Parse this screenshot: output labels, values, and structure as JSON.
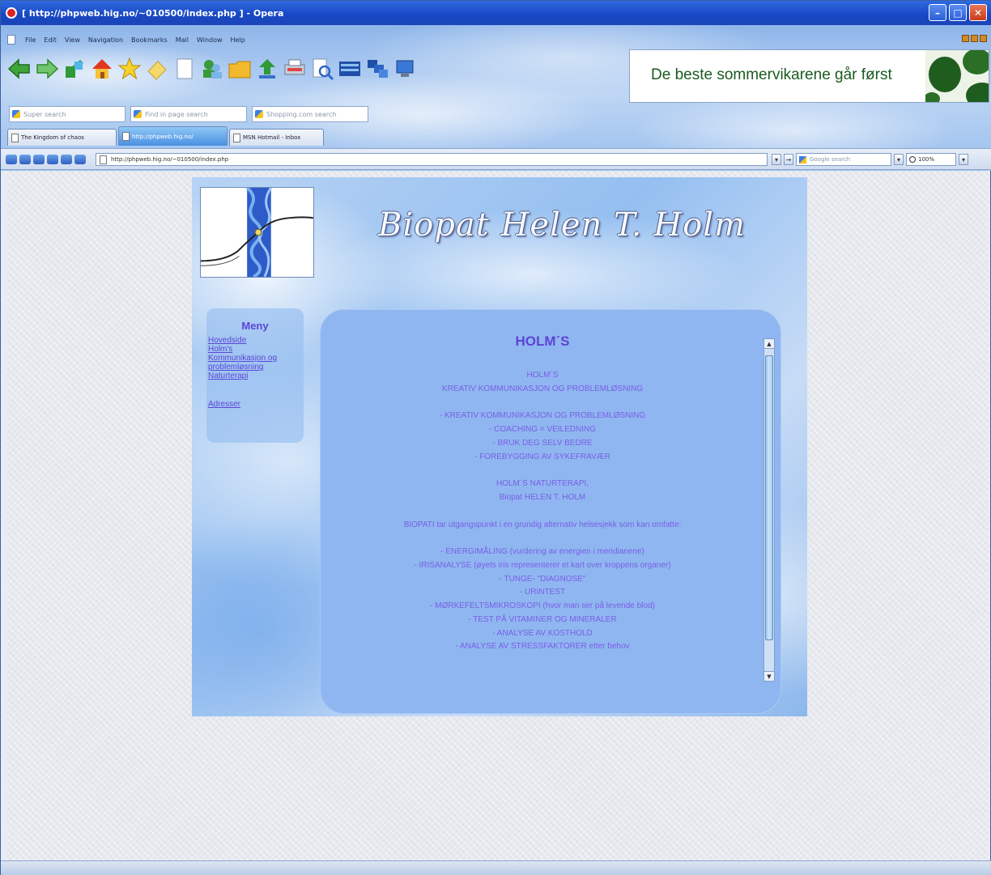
{
  "window": {
    "title": "[ http://phpweb.hig.no/~010500/index.php ] - Opera"
  },
  "menubar": {
    "items": [
      "File",
      "Edit",
      "View",
      "Navigation",
      "Bookmarks",
      "Mail",
      "Window",
      "Help"
    ]
  },
  "toolbar": {
    "icons": [
      "back-icon",
      "forward-icon",
      "reload-icon",
      "home-icon",
      "bookmarks-icon",
      "notes-icon",
      "page-icon",
      "contacts-icon",
      "folder-icon",
      "transfers-icon",
      "print-icon",
      "find-icon",
      "windows-icon",
      "panels-icon",
      "monitor-icon"
    ]
  },
  "ad": {
    "text": "De beste sommervikarene går først"
  },
  "search": {
    "fields": [
      "Super search",
      "Find in page search",
      "Shopping.com search"
    ]
  },
  "tabs": [
    {
      "label": "The Kingdom of chaos"
    },
    {
      "label": "http://phpweb.hig.no/"
    },
    {
      "label": "MSN Hotmail - Inbox"
    }
  ],
  "address": {
    "url": "http://phpweb.hig.no/~010500/index.php",
    "google_placeholder": "Google search",
    "zoom": "100%"
  },
  "site": {
    "title": "Biopat Helen T. Holm",
    "menu": {
      "title": "Meny",
      "links": [
        "Hovedside",
        "Holm's",
        "Kommunikasjon og",
        "problemløsning",
        "Naturterapi",
        "Adresser"
      ]
    },
    "content": {
      "heading": "HOLM´S",
      "lines": [
        "HOLM´S",
        "KREATIV KOMMUNIKASJON OG PROBLEMLØSNING",
        "",
        "- KREATIV KOMMUNIKASJON OG PROBLEMLØSNING",
        "- COACHING = VEILEDNING",
        "- BRUK DEG SELV BEDRE",
        "- FOREBYGGING AV SYKEFRAVÆR",
        "",
        "HOLM´S NATURTERAPI,",
        "Biopat HELEN T. HOLM",
        "",
        "BIOPATI tar utgangspunkt i en grundig alternativ helsesjekk som kan omfatte:",
        "",
        "- ENERGIMÅLING (vurdering av energien i meridianene)",
        "- IRISANALYSE (øyets iris representerer et kart over kroppens organer)",
        "- TUNGE- \"DIAGNOSE\"",
        "- URINTEST",
        "- MØRKEFELTSMIKROSKOPI (hvor man ser på levende blod)",
        "- TEST PÅ VITAMINER OG MINERALER",
        "- ANALYSE AV KOSTHOLD",
        "- ANALYSE AV STRESSFAKTORER etter behov"
      ]
    }
  }
}
